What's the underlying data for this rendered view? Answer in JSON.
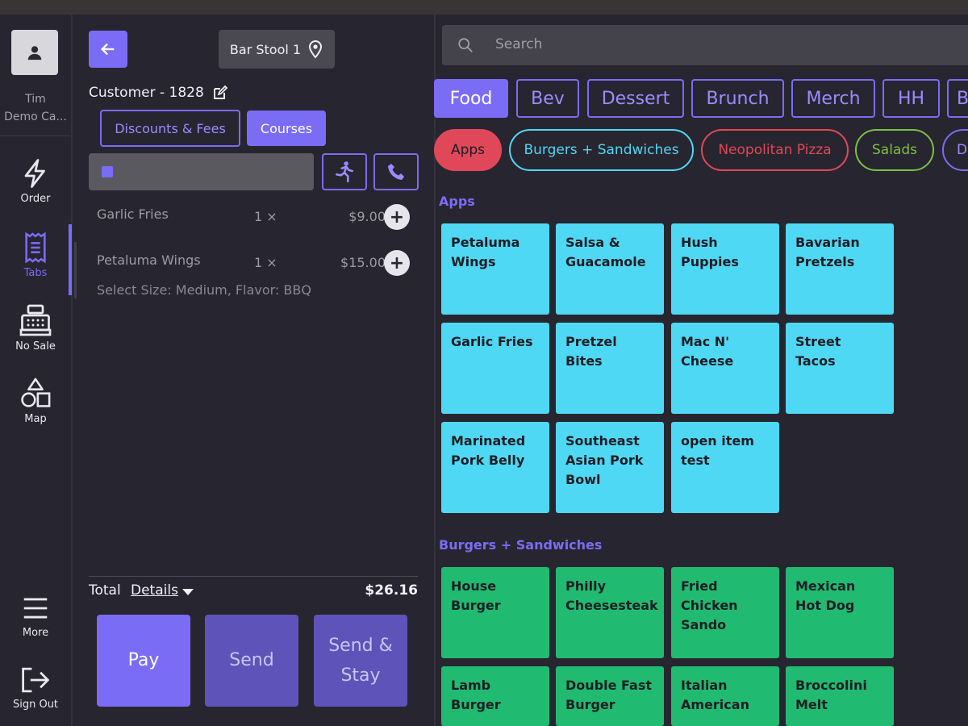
{
  "nav": {
    "user_name": "Tim",
    "user_org": "Demo Ca...",
    "items": [
      {
        "label": "Order",
        "icon": "lightning-icon"
      },
      {
        "label": "Tabs",
        "icon": "receipt-icon"
      },
      {
        "label": "No Sale",
        "icon": "cash-register-icon"
      },
      {
        "label": "Map",
        "icon": "shapes-icon"
      },
      {
        "label": "More",
        "icon": "hamburger-menu-icon"
      },
      {
        "label": "Sign Out",
        "icon": "sign-out-icon"
      }
    ]
  },
  "order": {
    "table_label": "Bar Stool 1",
    "customer_label": "Customer - 1828",
    "discounts_label": "Discounts & Fees",
    "courses_label": "Courses",
    "lines": [
      {
        "name": "Garlic Fries",
        "qty": "1 ×",
        "price": "$9.00",
        "modifiers": ""
      },
      {
        "name": "Petaluma Wings",
        "qty": "1 ×",
        "price": "$15.00",
        "modifiers": "Select Size: Medium, Flavor: BBQ"
      }
    ],
    "total_label": "Total",
    "details_label": "Details",
    "total_value": "$26.16",
    "pay_label": "Pay",
    "send_label": "Send",
    "send_stay_label": "Send & Stay"
  },
  "menu": {
    "search_placeholder": "Search",
    "tabs": [
      "Food",
      "Bev",
      "Dessert",
      "Brunch",
      "Merch",
      "HH",
      "B"
    ],
    "selected_tab": "Food",
    "categories": [
      {
        "label": "Apps",
        "color": "#e0485a",
        "filled": true
      },
      {
        "label": "Burgers + Sandwiches",
        "color": "#4fd8f4",
        "filled": false
      },
      {
        "label": "Neopolitan Pizza",
        "color": "#e0485a",
        "filled": false
      },
      {
        "label": "Salads",
        "color": "#7bc043",
        "filled": false
      },
      {
        "label": "D",
        "color": "#7b6cf6",
        "filled": false
      }
    ],
    "sections": [
      {
        "title": "Apps",
        "items": [
          "Petaluma Wings",
          "Salsa & Guacamole",
          "Hush Puppies",
          "Bavarian Pretzels",
          "Garlic Fries",
          "Pretzel Bites",
          "Mac N' Cheese",
          "Street Tacos",
          "Marinated Pork Belly",
          "Southeast Asian Pork Bowl",
          "open item test"
        ]
      },
      {
        "title": "Burgers + Sandwiches",
        "items": [
          "House Burger",
          "Philly Cheesesteak",
          "Fried Chicken Sando",
          "Mexican Hot Dog",
          "Lamb Burger",
          "Double Fast Burger",
          "Italian American",
          "Broccolini Melt"
        ]
      }
    ]
  },
  "colors": {
    "accent": "#7b6cf6",
    "apps_tile": "#4fd8f4",
    "burger_tile": "#20bb71",
    "background": "#27252f"
  }
}
